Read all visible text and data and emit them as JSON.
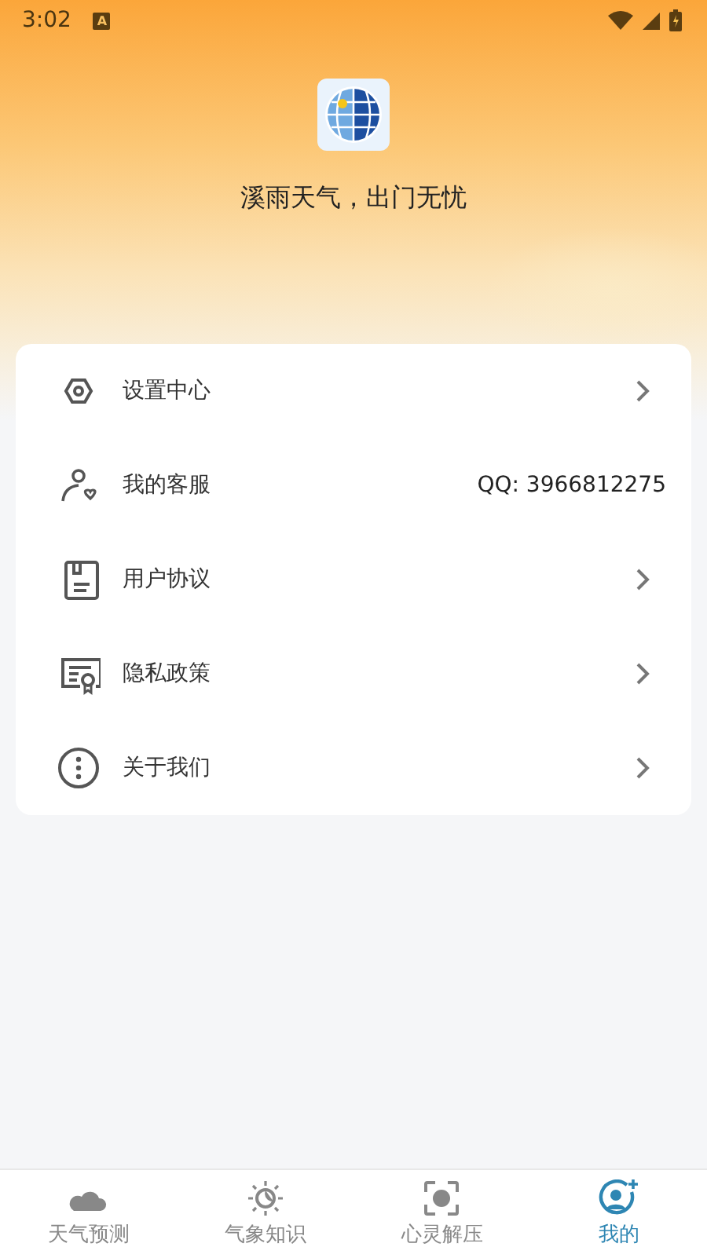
{
  "status_bar": {
    "time": "3:02",
    "notification": "A"
  },
  "header": {
    "slogan": "溪雨天气，出门无忧"
  },
  "menu": [
    {
      "label": "设置中心",
      "kind": "chevron"
    },
    {
      "label": "我的客服",
      "kind": "value",
      "value": "QQ: 3966812275"
    },
    {
      "label": "用户协议",
      "kind": "chevron"
    },
    {
      "label": "隐私政策",
      "kind": "chevron"
    },
    {
      "label": "关于我们",
      "kind": "chevron"
    }
  ],
  "tabs": [
    {
      "label": "天气预测",
      "selected": false
    },
    {
      "label": "气象知识",
      "selected": false
    },
    {
      "label": "心灵解压",
      "selected": false
    },
    {
      "label": "我的",
      "selected": true
    }
  ]
}
